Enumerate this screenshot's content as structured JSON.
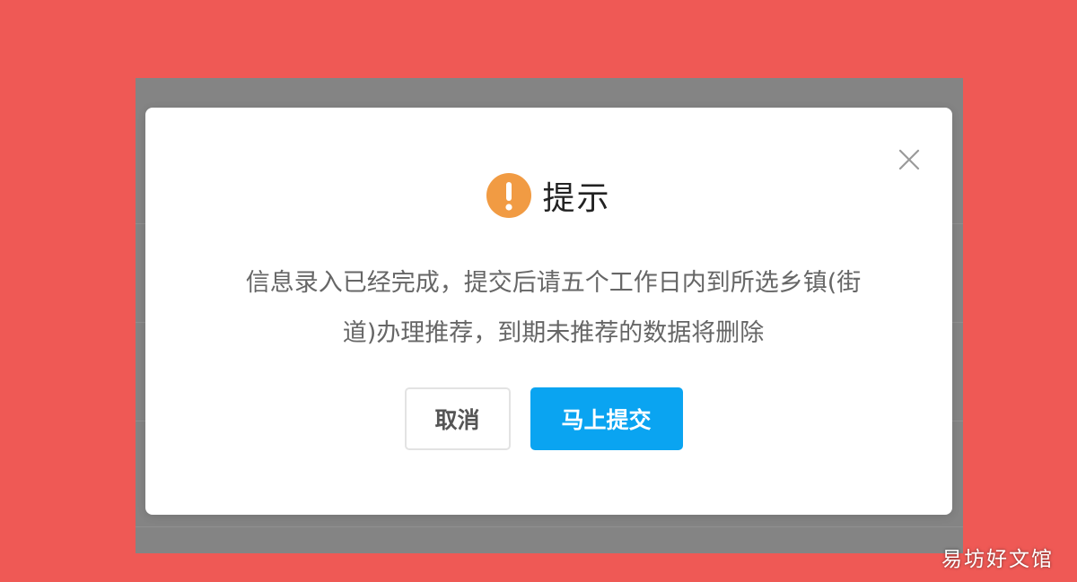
{
  "dialog": {
    "title": "提示",
    "message_line1": "信息录入已经完成，提交后请五个工作日内到所选乡镇(街",
    "message_line2": "道)办理推荐，到期未推荐的数据将删除",
    "cancel_label": "取消",
    "submit_label": "马上提交",
    "icon": "warning-icon",
    "close_icon": "close-icon"
  },
  "colors": {
    "background": "#ef5955",
    "overlay": "#848484",
    "warning": "#f19b43",
    "primary": "#0aa4f1"
  },
  "watermark": "易坊好文馆"
}
